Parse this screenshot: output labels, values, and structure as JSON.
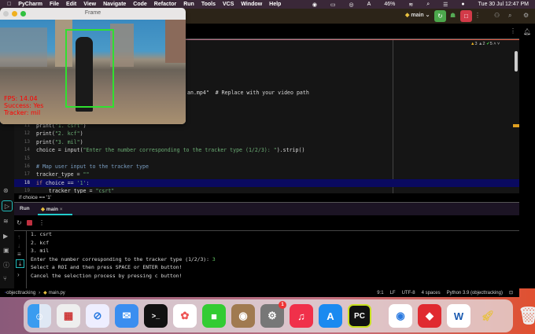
{
  "menubar": {
    "app": "PyCharm",
    "items": [
      "File",
      "Edit",
      "View",
      "Navigate",
      "Code",
      "Refactor",
      "Run",
      "Tools",
      "VCS",
      "Window",
      "Help"
    ],
    "battery": "46%",
    "datetime": "Tue 30 Jul  12:47 PM"
  },
  "toolbar": {
    "run_config": "main"
  },
  "inspections": {
    "warnings": "3",
    "weak_warnings": "2",
    "ok": "5"
  },
  "frame": {
    "title": "Frame",
    "fps": "FPS: 14.04",
    "success": "Success: Yes",
    "tracker": "Tracker: mil"
  },
  "editor": {
    "partial_line": "an.mp4\"  # Replace with your video path",
    "lines": [
      {
        "n": "11",
        "code": "print(\"1. csrt\")"
      },
      {
        "n": "12",
        "code": "print(\"2. kcf\")"
      },
      {
        "n": "13",
        "code": "print(\"3. mil\")"
      },
      {
        "n": "14",
        "code": "choice = input(\"Enter the number corresponding to the tracker type (1/2/3): \").strip()"
      },
      {
        "n": "15",
        "code": ""
      },
      {
        "n": "16",
        "code": "# Map user input to the tracker type"
      },
      {
        "n": "17",
        "code": "tracker_type = \"\""
      },
      {
        "n": "18",
        "code": "if choice == '1':"
      },
      {
        "n": "19",
        "code": "    tracker_type = \"csrt\""
      }
    ],
    "breadcrumb": "if choice == '1'"
  },
  "run": {
    "label": "Run",
    "tab": "main",
    "output": [
      "1. csrt",
      "2. kcf",
      "3. mil",
      "Enter the number corresponding to the tracker type (1/2/3): ",
      "Select a ROI and then press SPACE or ENTER button!",
      "Cancel the selection process by pressing c button!"
    ],
    "input_value": "3"
  },
  "status": {
    "project": "objecttracking",
    "file": "main.py",
    "position": "9:1",
    "line_sep": "LF",
    "encoding": "UTF-8",
    "indent": "4 spaces",
    "interpreter": "Python 3.9 (objecttracking)"
  },
  "dock": {
    "pycharm": "PC",
    "notifications_badge": "1"
  }
}
